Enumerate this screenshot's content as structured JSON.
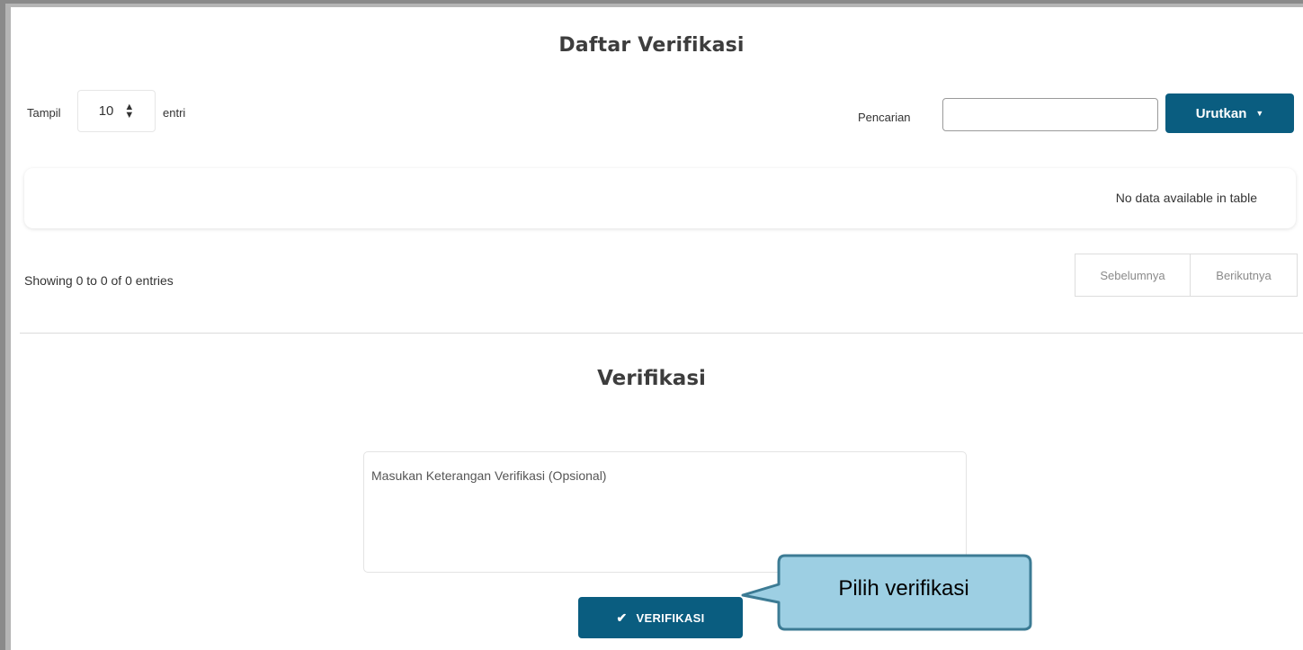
{
  "header": {
    "title": "Daftar Verifikasi"
  },
  "length": {
    "prefix": "Tampil",
    "value": "10",
    "suffix": "entri"
  },
  "search": {
    "label": "Pencarian",
    "value": ""
  },
  "sort": {
    "label": "Urutkan"
  },
  "table": {
    "empty_message": "No data available in table"
  },
  "info": {
    "text": "Showing 0 to 0 of 0 entries"
  },
  "pagination": {
    "prev": "Sebelumnya",
    "next": "Berikutnya"
  },
  "verify_section": {
    "title": "Verifikasi",
    "note_placeholder": "Masukan Keterangan Verifikasi (Opsional)",
    "button_label": "VERIFIKASI"
  },
  "callout": {
    "text": "Pilih verifikasi"
  },
  "colors": {
    "primary": "#0a5d80",
    "callout_fill": "#9dcfe3",
    "callout_border": "#3c7b94"
  },
  "icons": {
    "check": "check-icon",
    "caret": "caret-down-icon",
    "sort_arrows": "updown-icon"
  }
}
